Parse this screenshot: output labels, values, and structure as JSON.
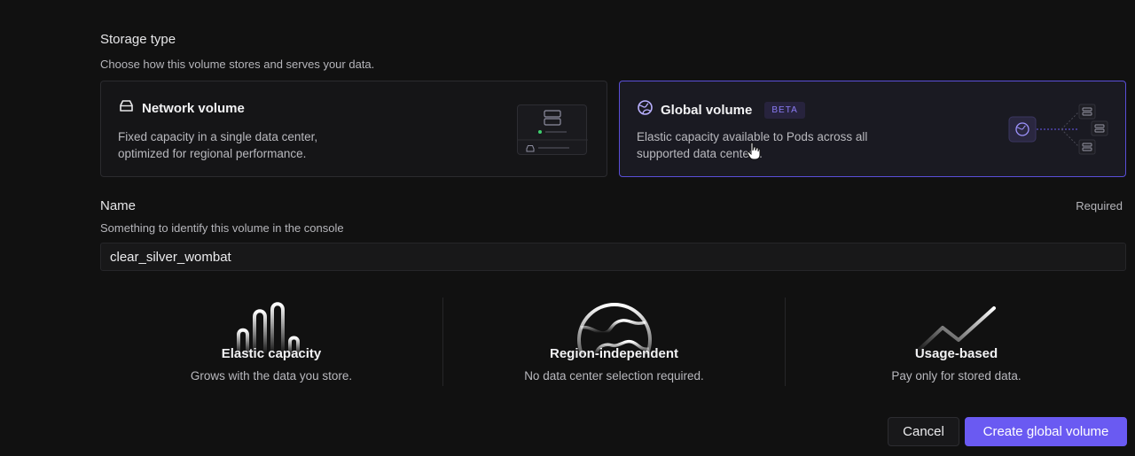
{
  "storage": {
    "title": "Storage type",
    "subtitle": "Choose how this volume stores and serves your data.",
    "options": [
      {
        "title": "Network volume",
        "description": "Fixed capacity in a single data center, optimized for regional performance.",
        "icon": "drive-icon"
      },
      {
        "title": "Global volume",
        "badge": "BETA",
        "description": "Elastic capacity available to Pods across all supported data centers.",
        "icon": "globe-icon",
        "selected": true
      }
    ]
  },
  "name": {
    "label": "Name",
    "required_text": "Required",
    "subtitle": "Something to identify this volume in the console",
    "value": "clear_silver_wombat"
  },
  "features": [
    {
      "title": "Elastic capacity",
      "description": "Grows with the data you store.",
      "icon": "elastic-bars-icon"
    },
    {
      "title": "Region-independent",
      "description": "No data center selection required.",
      "icon": "globe-icon"
    },
    {
      "title": "Usage-based",
      "description": "Pay only for stored data.",
      "icon": "trend-line-icon"
    }
  ],
  "actions": {
    "cancel_label": "Cancel",
    "create_label": "Create global volume"
  },
  "colors": {
    "accent": "#6a5af2",
    "selected_border": "#5a4fd8",
    "badge_text": "#8b7cf6",
    "status_green": "#3ecf6e"
  }
}
